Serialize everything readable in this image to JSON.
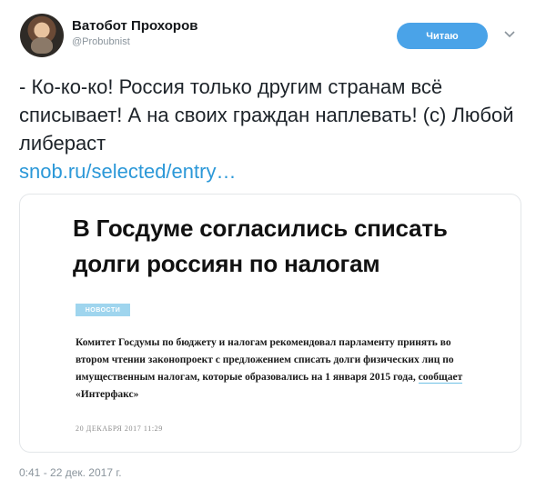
{
  "user": {
    "display_name": "Ватобот Прохоров",
    "handle": "@Probubnist",
    "follow_label": "Читаю"
  },
  "icons": {
    "menu": "chevron-down-icon",
    "avatar": "avatar"
  },
  "tweet": {
    "text": "- Ко-ко-ко! Россия только другим странам всё списывает! А на своих граждан наплевать! (с) Любой либераст",
    "link": "snob.ru/selected/entry…",
    "timestamp": "0:41 - 22 дек. 2017 г."
  },
  "card": {
    "title": "В Госдуме согласились списать долги россиян по налогам",
    "tag": "НОВОСТИ",
    "body_main": "Комитет Госдумы по бюджету и налогам рекомендовал парламенту принять во втором чтении законопроект с предложением списать долги физических лиц по имущественным налогам, которые образовались на 1 января 2015 года, ",
    "body_link": "сообщает",
    "body_end": " «Интерфакс»",
    "date": "20 ДЕКАБРЯ 2017 11:29"
  },
  "colors": {
    "accent": "#4aa3e8",
    "link": "#2b98d8",
    "tag": "#9fd5ee",
    "muted": "#8a949c"
  }
}
